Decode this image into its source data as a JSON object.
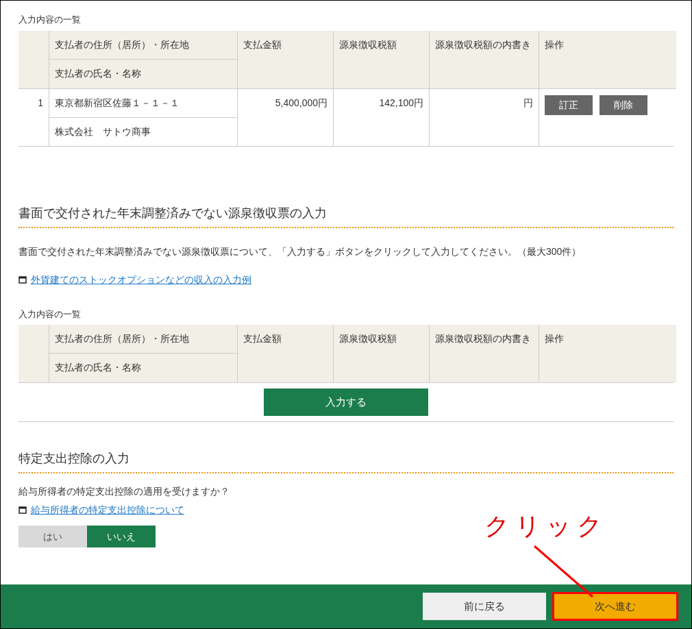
{
  "table_1": {
    "caption": "入力内容の一覧",
    "columns": {
      "address": "支払者の住所（居所）・所在地",
      "name": "支払者の氏名・名称",
      "amount": "支払金額",
      "tax": "源泉徴収税額",
      "breakdown": "源泉徴収税額の内書き",
      "actions": "操作"
    },
    "rows": [
      {
        "number": "1",
        "address": "東京都新宿区佐藤１－１－１",
        "name": "株式会社　サトウ商事",
        "amount": "5,400,000円",
        "tax": "142,100円",
        "breakdown": "円",
        "buttons": [
          "訂正",
          "削除"
        ]
      }
    ]
  },
  "section_paper": {
    "heading": "書面で交付された年末調整済みでない源泉徴収票の入力",
    "description": "書面で交付された年末調整済みでない源泉徴収票について、「入力する」ボタンをクリックして入力してください。（最大300件）",
    "link": "外貨建てのストックオプションなどの収入の入力例",
    "table": {
      "caption": "入力内容の一覧",
      "columns": {
        "address": "支払者の住所（居所）・所在地",
        "name": "支払者の氏名・名称",
        "amount": "支払金額",
        "tax": "源泉徴収税額",
        "breakdown": "源泉徴収税額の内書き",
        "actions": "操作"
      }
    },
    "add_button": "入力する"
  },
  "section_special": {
    "heading": "特定支出控除の入力",
    "question": "給与所得者の特定支出控除の適用を受けますか？",
    "link": "給与所得者の特定支出控除について",
    "options": [
      {
        "label": "はい",
        "selected": false
      },
      {
        "label": "いいえ",
        "selected": true
      }
    ]
  },
  "footer": {
    "back_button": "前に戻る",
    "next_button": "次へ進む",
    "next_highlighted": true
  },
  "annotation": {
    "text": "クリック"
  }
}
